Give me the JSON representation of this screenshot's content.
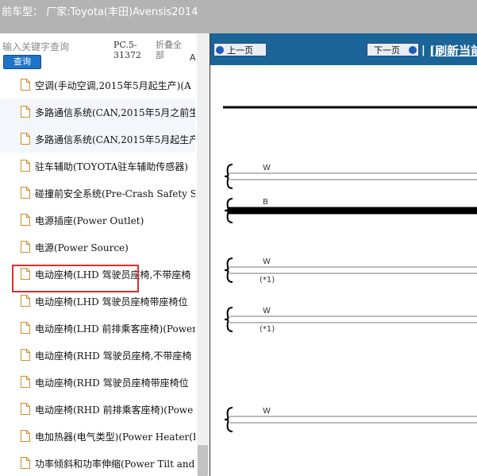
{
  "titlebar": {
    "title": "前车型： 厂家:Toyota(丰田)Avensis2014"
  },
  "search": {
    "placeholder": "输入关键字查询",
    "button_label": "查询"
  },
  "header": {
    "code": "PC.5-31372",
    "collapse": "折叠全部",
    "letter": "A"
  },
  "tree": {
    "items": [
      {
        "label": "空调(手动空调,2015年5月起生产)(A"
      },
      {
        "label": "多路通信系统(CAN,2015年5月之前生"
      },
      {
        "label": "多路通信系统(CAN,2015年5月起生产"
      },
      {
        "label": "驻车辅助(TOYOTA驻车辅助传感器)"
      },
      {
        "label": "碰撞前安全系统(Pre-Crash Safety Sy"
      },
      {
        "label": "电源插座(Power Outlet)"
      },
      {
        "label": "电源(Power Source)"
      },
      {
        "label": "电动座椅(LHD 驾驶员座椅,不带座椅"
      },
      {
        "label": "电动座椅(LHD 驾驶员座椅带座椅位"
      },
      {
        "label": "电动座椅(LHD 前排乘客座椅)(Power"
      },
      {
        "label": "电动座椅(RHD 驾驶员座椅,不带座椅"
      },
      {
        "label": "电动座椅(RHD 驾驶员座椅带座椅位"
      },
      {
        "label": "电动座椅(RHD 前排乘客座椅)(Powe"
      },
      {
        "label": "电加热器(电气类型)(Power Heater(El"
      },
      {
        "label": "功率倾斜和功率伸缩(Power Tilt and"
      }
    ]
  },
  "toolbar": {
    "prev_label": "上一页",
    "next_label": "下一页",
    "separator": "|",
    "refresh_label": "[刷新当前"
  },
  "diagram": {
    "wires": [
      {
        "color": "W",
        "note": ""
      },
      {
        "color": "B",
        "note": ""
      },
      {
        "color": "W",
        "note": "(*1)"
      },
      {
        "color": "W",
        "note": "(*1)"
      },
      {
        "color": "W",
        "note": ""
      }
    ]
  }
}
